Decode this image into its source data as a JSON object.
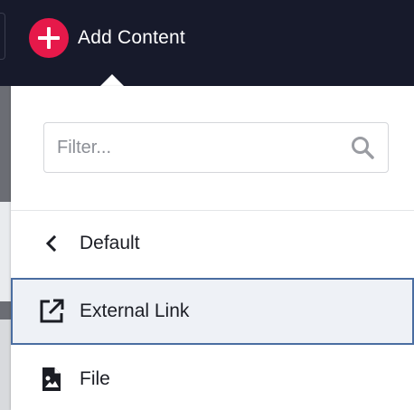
{
  "header": {
    "add_content_label": "Add Content"
  },
  "panel": {
    "filter": {
      "placeholder": "Filter...",
      "value": ""
    },
    "back_item": {
      "label": "Default",
      "icon": "chevron-left-icon"
    },
    "items": [
      {
        "label": "External Link",
        "icon": "external-link-icon",
        "selected": true
      },
      {
        "label": "File",
        "icon": "file-image-icon",
        "selected": false
      }
    ]
  },
  "colors": {
    "header_bg": "#171a2b",
    "accent": "#e6194a",
    "selected_border": "#4a6da1",
    "selected_bg": "#eef1f6"
  }
}
